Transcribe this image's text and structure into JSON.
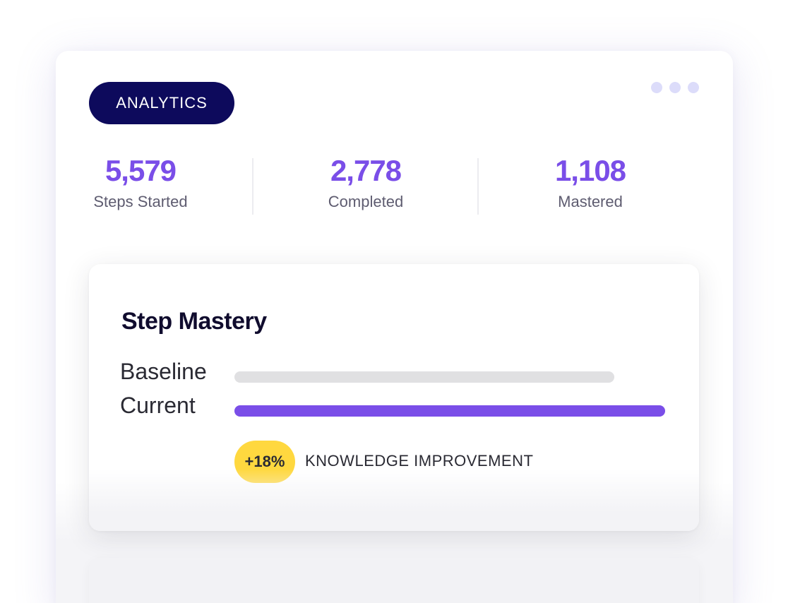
{
  "header": {
    "badge_label": "ANALYTICS",
    "menu_icon": "more-dots-icon"
  },
  "stats": [
    {
      "value": "5,579",
      "label": "Steps Started"
    },
    {
      "value": "2,778",
      "label": "Completed"
    },
    {
      "value": "1,108",
      "label": "Mastered"
    }
  ],
  "mastery": {
    "title": "Step Mastery",
    "rows": [
      {
        "label": "Baseline",
        "level": 0.88
      },
      {
        "label": "Current",
        "level": 1.0
      }
    ],
    "improvement_value": "+18%",
    "improvement_label": "KNOWLEDGE IMPROVEMENT"
  },
  "colors": {
    "badge_bg": "#0d0a5c",
    "accent": "#7a4ee8",
    "baseline_bar": "#e0e0e2",
    "highlight": "#ffd83f",
    "menu_dot": "#dcdcfa"
  }
}
